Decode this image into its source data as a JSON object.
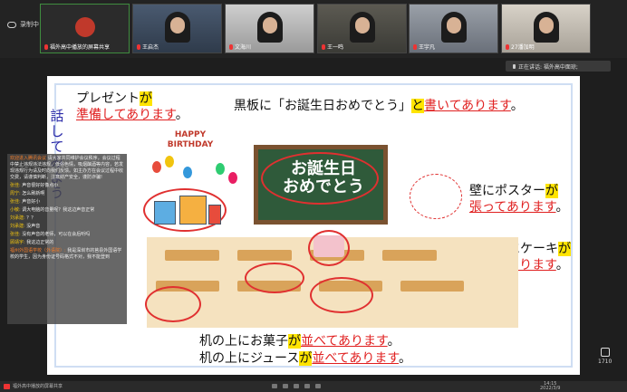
{
  "app": {
    "recording_label": "录制中",
    "share_label": "福外高中播放的屏幕共享",
    "speaker_label": "正在讲话: 福外高中面琼;",
    "likes_count": "1710",
    "time": "14:15",
    "date": "2022/3/9"
  },
  "participants": [
    {
      "name": "福外高中播放的屏幕共享"
    },
    {
      "name": "王启杰"
    },
    {
      "name": "文海川"
    },
    {
      "name": "王一鸣"
    },
    {
      "name": "王宇凡"
    },
    {
      "name": "27潘加明"
    }
  ],
  "slide": {
    "present_line1": "プレゼント",
    "present_ga": "が",
    "present_line2": "準備してあります",
    "present_end": "。",
    "board_pre": "黒板に「お誕生日おめでとう」",
    "board_to": "と",
    "board_red": "書いてあります",
    "board_end": "。",
    "board_text": "お誕生日\nおめでとう",
    "wall_pre": "壁にポスター",
    "wall_ga": "が",
    "wall_red": "張ってあります",
    "wall_end": "。",
    "desk_pre": "机の上にケーキ",
    "desk_ga": "が",
    "desk_red": "置いてあります",
    "desk_end": "。",
    "sweets_pre": "机の上にお菓子",
    "sweets_ga": "が",
    "sweets_red": "並べてあります",
    "sweets_end": "。",
    "juice_pre": "机の上にジュース",
    "juice_ga": "が",
    "juice_red": "並べてあります",
    "juice_end": "。",
    "vertical_text": "話してみよう",
    "happy_birthday": "HAPPY BIRTHDAY"
  },
  "chat": [
    {
      "who": "欢迎进入腾讯会议",
      "text": "请大家共同维护会议秩序，会议过程中禁止违规违法违规，低俗色情，吸烟酗酒等内容，若发现违规行为请及时向我们反馈。如主办方在会议过程中收交费，请谨慎判断，注意财产安全，谨防诈骗!"
    },
    {
      "who": "张佳:",
      "text": "声音很好好像点小"
    },
    {
      "who": "周宁:",
      "text": "怎么刷新啊"
    },
    {
      "who": "张佳:",
      "text": "声音好小"
    },
    {
      "who": "小敏:",
      "text": "调大电脑的音量呢？我这边声音正常"
    },
    {
      "who": "刘承建:",
      "text": "？？"
    },
    {
      "who": "刘承建:",
      "text": "没声音"
    },
    {
      "who": "张佳:",
      "text": "没有声音的老师，可以在会后听吗"
    },
    {
      "who": "顾靖宇:",
      "text": "我这边正常的"
    },
    {
      "who": "福州外国语学校（外语院）:",
      "text": "我是深圳市的莒县外国语学校的学生，因为身份证号码格式不对，我不能登到"
    }
  ]
}
